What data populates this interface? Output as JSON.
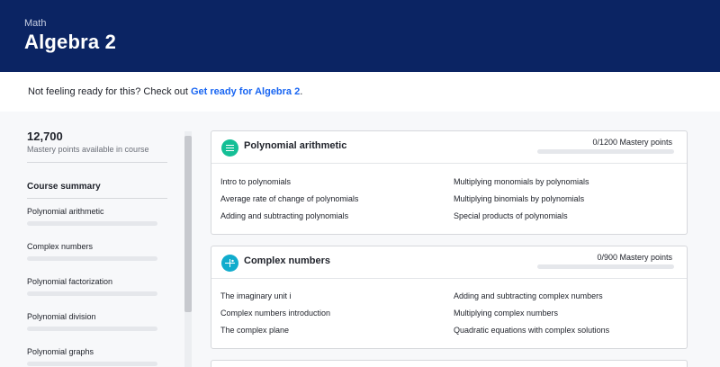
{
  "header": {
    "subject": "Math",
    "title": "Algebra 2"
  },
  "banner": {
    "prefix": "Not feeling ready for this? Check out ",
    "link": "Get ready for Algebra 2",
    "suffix": "."
  },
  "sidebar": {
    "mastery_total": "12,700",
    "mastery_label": "Mastery points available in course",
    "summary_title": "Course summary",
    "items": [
      {
        "label": "Polynomial arithmetic"
      },
      {
        "label": "Complex numbers"
      },
      {
        "label": "Polynomial factorization"
      },
      {
        "label": "Polynomial division"
      },
      {
        "label": "Polynomial graphs"
      }
    ]
  },
  "units": [
    {
      "title": "Polynomial arithmetic",
      "mastery": "0/1200 Mastery points",
      "lessons_left": [
        "Intro to polynomials",
        "Average rate of change of polynomials",
        "Adding and subtracting polynomials"
      ],
      "lessons_right": [
        "Multiplying monomials by polynomials",
        "Multiplying binomials by polynomials",
        "Special products of polynomials"
      ]
    },
    {
      "title": "Complex numbers",
      "mastery": "0/900 Mastery points",
      "lessons_left": [
        "The imaginary unit i",
        "Complex numbers introduction",
        "The complex plane"
      ],
      "lessons_right": [
        "Adding and subtracting complex numbers",
        "Multiplying complex numbers",
        "Quadratic equations with complex solutions"
      ]
    }
  ],
  "colors": {
    "header_bg": "#0b2463",
    "link": "#1865f2",
    "icon_teal": "#11accd"
  },
  "icons": {
    "unit1": "polynomial-icon",
    "unit2": "complex-numbers-icon"
  }
}
